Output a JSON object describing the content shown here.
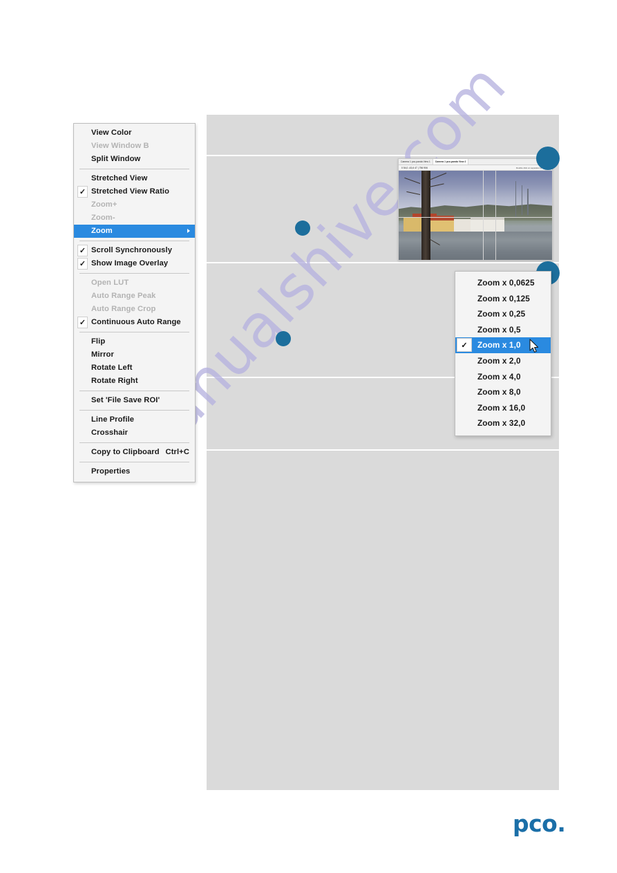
{
  "document": {
    "brand_logo": "pco.",
    "brand_color": "#1b6fa8",
    "watermark": "manualshive.com",
    "watermark_color": "#b7b3e0",
    "page_background": "#ffffff",
    "panel_background": "#dadada"
  },
  "context_menu": {
    "name": "view-context-menu",
    "highlight_color": "#2a8ae0",
    "items": [
      {
        "label": "View Color",
        "state": "normal",
        "checked": false,
        "shortcut": "",
        "submenu": false
      },
      {
        "label": "View Window B",
        "state": "disabled",
        "checked": false,
        "shortcut": "",
        "submenu": false
      },
      {
        "label": "Split Window",
        "state": "normal",
        "checked": false,
        "shortcut": "",
        "submenu": false
      },
      {
        "label": "separator",
        "state": "separator",
        "checked": false,
        "shortcut": "",
        "submenu": false
      },
      {
        "label": "Stretched View",
        "state": "normal",
        "checked": false,
        "shortcut": "",
        "submenu": false
      },
      {
        "label": "Stretched View Ratio",
        "state": "normal",
        "checked": true,
        "shortcut": "",
        "submenu": false
      },
      {
        "label": "Zoom+",
        "state": "disabled",
        "checked": false,
        "shortcut": "",
        "submenu": false
      },
      {
        "label": "Zoom-",
        "state": "disabled",
        "checked": false,
        "shortcut": "",
        "submenu": false
      },
      {
        "label": "Zoom",
        "state": "selected",
        "checked": false,
        "shortcut": "",
        "submenu": true
      },
      {
        "label": "separator",
        "state": "separator",
        "checked": false,
        "shortcut": "",
        "submenu": false
      },
      {
        "label": "Scroll Synchronously",
        "state": "normal",
        "checked": true,
        "shortcut": "",
        "submenu": false
      },
      {
        "label": "Show Image Overlay",
        "state": "normal",
        "checked": true,
        "shortcut": "",
        "submenu": false
      },
      {
        "label": "separator",
        "state": "separator",
        "checked": false,
        "shortcut": "",
        "submenu": false
      },
      {
        "label": "Open LUT",
        "state": "disabled",
        "checked": false,
        "shortcut": "",
        "submenu": false
      },
      {
        "label": "Auto Range Peak",
        "state": "disabled",
        "checked": false,
        "shortcut": "",
        "submenu": false
      },
      {
        "label": "Auto Range Crop",
        "state": "disabled",
        "checked": false,
        "shortcut": "",
        "submenu": false
      },
      {
        "label": "Continuous Auto Range",
        "state": "normal",
        "checked": true,
        "shortcut": "",
        "submenu": false
      },
      {
        "label": "separator",
        "state": "separator",
        "checked": false,
        "shortcut": "",
        "submenu": false
      },
      {
        "label": "Flip",
        "state": "normal",
        "checked": false,
        "shortcut": "",
        "submenu": false
      },
      {
        "label": "Mirror",
        "state": "normal",
        "checked": false,
        "shortcut": "",
        "submenu": false
      },
      {
        "label": "Rotate Left",
        "state": "normal",
        "checked": false,
        "shortcut": "",
        "submenu": false
      },
      {
        "label": "Rotate Right",
        "state": "normal",
        "checked": false,
        "shortcut": "",
        "submenu": false
      },
      {
        "label": "separator",
        "state": "separator",
        "checked": false,
        "shortcut": "",
        "submenu": false
      },
      {
        "label": "Set 'File Save ROI'",
        "state": "normal",
        "checked": false,
        "shortcut": "",
        "submenu": false
      },
      {
        "label": "separator",
        "state": "separator",
        "checked": false,
        "shortcut": "",
        "submenu": false
      },
      {
        "label": "Line Profile",
        "state": "normal",
        "checked": false,
        "shortcut": "",
        "submenu": false
      },
      {
        "label": "Crosshair",
        "state": "normal",
        "checked": false,
        "shortcut": "",
        "submenu": false
      },
      {
        "label": "separator",
        "state": "separator",
        "checked": false,
        "shortcut": "",
        "submenu": false
      },
      {
        "label": "Copy to Clipboard",
        "state": "normal",
        "checked": false,
        "shortcut": "Ctrl+C",
        "submenu": false
      },
      {
        "label": "separator",
        "state": "separator",
        "checked": false,
        "shortcut": "",
        "submenu": false
      },
      {
        "label": "Properties",
        "state": "normal",
        "checked": false,
        "shortcut": "",
        "submenu": false
      }
    ]
  },
  "zoom_submenu": {
    "name": "zoom-submenu",
    "highlight_color": "#2a8ae0",
    "items": [
      {
        "label": "Zoom x 0,0625",
        "selected": false
      },
      {
        "label": "Zoom x 0,125",
        "selected": false
      },
      {
        "label": "Zoom x 0,25",
        "selected": false
      },
      {
        "label": "Zoom x 0,5",
        "selected": false
      },
      {
        "label": "Zoom x 1,0",
        "selected": true
      },
      {
        "label": "Zoom x 2,0",
        "selected": false
      },
      {
        "label": "Zoom x 4,0",
        "selected": false
      },
      {
        "label": "Zoom x 8,0",
        "selected": false
      },
      {
        "label": "Zoom x 16,0",
        "selected": false
      },
      {
        "label": "Zoom x 32,0",
        "selected": false
      }
    ]
  },
  "camera_window": {
    "name": "camera-preview-window",
    "tabs": [
      {
        "label": "Camera 1 pco.panda View 1",
        "active": false
      },
      {
        "label": "Camera 1 pco.panda View 2",
        "active": true
      }
    ],
    "toolbar_values": "0  54,0  -43,6  47 | 756  906",
    "hint": "Double click on separator to remove",
    "overlay": "crosshair"
  },
  "badges": [
    {
      "name": "callout-badge-1",
      "color": "#1c6e9c"
    },
    {
      "name": "callout-badge-2",
      "color": "#1c6e9c"
    },
    {
      "name": "callout-badge-3",
      "color": "#1c6e9c"
    },
    {
      "name": "callout-badge-4",
      "color": "#1c6e9c"
    }
  ]
}
